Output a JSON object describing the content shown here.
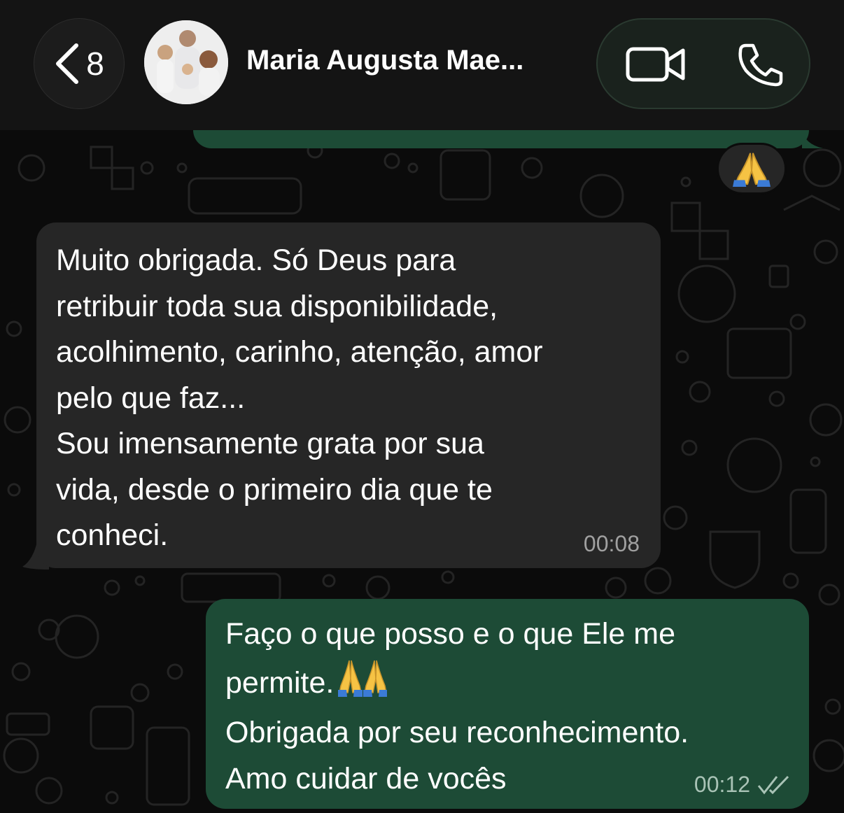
{
  "header": {
    "unread_count": "8",
    "contact_name": "Maria Augusta Mae..."
  },
  "icons": {
    "back": "chevron-left-icon",
    "video": "video-camera-icon",
    "phone": "phone-icon",
    "reaction": "folded-hands-emoji",
    "read_receipt": "double-check-icon"
  },
  "colors": {
    "incoming_bubble": "#262626",
    "outgoing_bubble": "#1d4b36",
    "background": "#0b0b0b"
  },
  "messages": [
    {
      "direction": "incoming",
      "lines": [
        "Muito obrigada. Só Deus para",
        "retribuir toda sua disponibilidade,",
        "acolhimento, carinho, atenção, amor",
        "pelo que faz...",
        "Sou imensamente grata por sua",
        "vida, desde o primeiro dia que te",
        "conheci."
      ],
      "time": "00:08"
    },
    {
      "direction": "outgoing",
      "line1": "Faço o que posso e o que Ele me",
      "line2": "permite.",
      "line3": "Obrigada por seu reconhecimento.",
      "line4": "Amo cuidar de vocês",
      "time": "00:12"
    }
  ]
}
